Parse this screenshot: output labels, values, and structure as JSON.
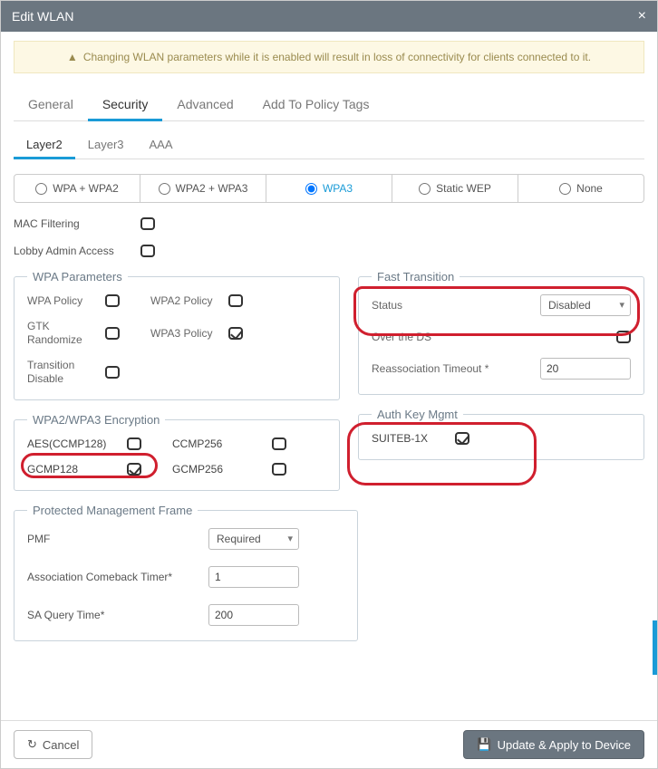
{
  "title": "Edit WLAN",
  "warning": "Changing WLAN parameters while it is enabled will result in loss of connectivity for clients connected to it.",
  "tabs": {
    "general": "General",
    "security": "Security",
    "advanced": "Advanced",
    "policy": "Add To Policy Tags"
  },
  "subtabs": {
    "layer2": "Layer2",
    "layer3": "Layer3",
    "aaa": "AAA"
  },
  "modes": {
    "wpa_wpa2": "WPA + WPA2",
    "wpa2_wpa3": "WPA2 + WPA3",
    "wpa3": "WPA3",
    "static_wep": "Static WEP",
    "none": "None"
  },
  "labels": {
    "mac_filtering": "MAC Filtering",
    "lobby_admin": "Lobby Admin Access",
    "wpa_params": "WPA Parameters",
    "wpa_policy": "WPA Policy",
    "wpa2_policy": "WPA2 Policy",
    "gtk_randomize": "GTK Randomize",
    "wpa3_policy": "WPA3 Policy",
    "transition_disable": "Transition Disable",
    "encryption": "WPA2/WPA3 Encryption",
    "aes_ccmp128": "AES(CCMP128)",
    "ccmp256": "CCMP256",
    "gcmp128": "GCMP128",
    "gcmp256": "GCMP256",
    "fast_transition": "Fast Transition",
    "status": "Status",
    "over_ds": "Over the DS",
    "reassoc_timeout": "Reassociation Timeout *",
    "auth_key_mgmt": "Auth Key Mgmt",
    "suiteb_1x": "SUITEB-1X",
    "pmf_section": "Protected Management Frame",
    "pmf": "PMF",
    "assoc_comeback": "Association Comeback Timer*",
    "sa_query": "SA Query Time*"
  },
  "values": {
    "ft_status": "Disabled",
    "reassoc_timeout": "20",
    "pmf_mode": "Required",
    "assoc_comeback": "1",
    "sa_query": "200"
  },
  "footer": {
    "cancel": "Cancel",
    "apply": "Update & Apply to Device"
  }
}
